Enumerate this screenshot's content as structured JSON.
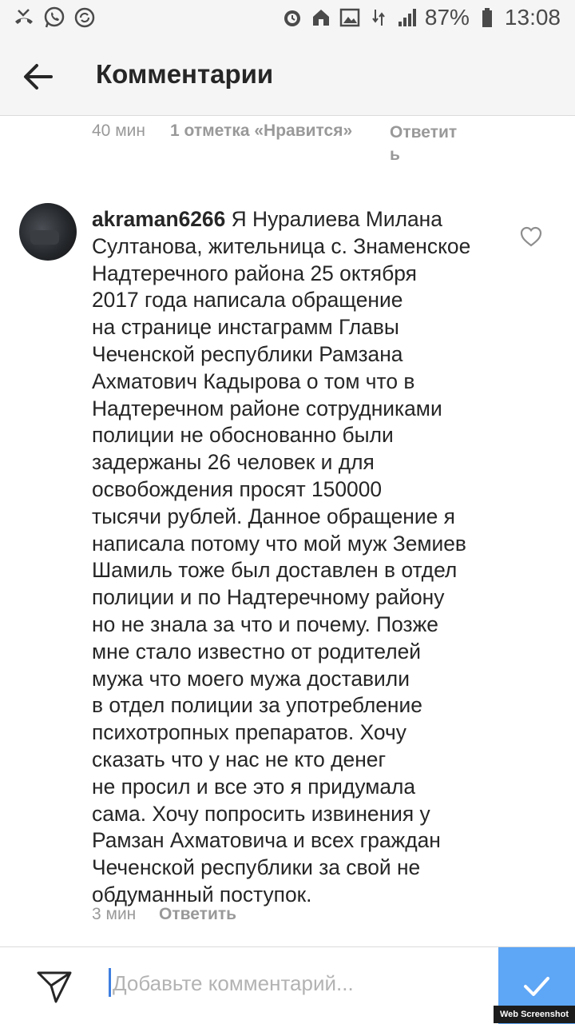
{
  "status_bar": {
    "battery": "87%",
    "time": "13:08",
    "icons_left": [
      "missed-call-icon",
      "whatsapp-icon",
      "sync-icon"
    ],
    "icons_right": [
      "alarm-icon",
      "home-icon",
      "image-icon",
      "data-icon",
      "signal-icon",
      "battery-icon"
    ]
  },
  "header": {
    "title": "Комментарии"
  },
  "previous_comment": {
    "time": "40 мин",
    "likes": "1 отметка «Нравится»",
    "reply_line1": "Ответит",
    "reply_line2": "ь"
  },
  "comment": {
    "username": "akraman6266",
    "lines": [
      "Я Нуралиева Милана",
      "Султанова, жительница с. Знаменское",
      "Надтеречного района 25 октября",
      "2017 года написала обращение",
      "на странице инстаграмм Главы",
      "Чеченской республики Рамзана",
      "Ахматович Кадырова о том что в",
      "Надтеречном районе сотрудниками",
      "полиции не обоснованно были",
      "задержаны 26 человек и для",
      "освобождения просят 150000",
      "тысячи рублей. Данное обращение я",
      "написала потому что мой муж Земиев",
      "Шамиль тоже был доставлен в отдел",
      "полиции и по Надтеречному району",
      "но не знала за что и почему. Позже",
      "мне стало известно от родителей",
      "мужа что моего мужа доставили",
      "в отдел полиции за употребление",
      "психотропных препаратов. Хочу",
      "сказать что у нас не кто денег",
      "не просил и все это я придумала",
      "сама. Хочу попросить извинения у",
      "Рамзан Ахматовича и всех граждан",
      "Чеченской республики за свой не",
      "обдуманный поступок."
    ],
    "time": "3 мин",
    "reply": "Ответить"
  },
  "input": {
    "placeholder": "Добавьте комментарий..."
  },
  "watermark": "Web Screenshot"
}
